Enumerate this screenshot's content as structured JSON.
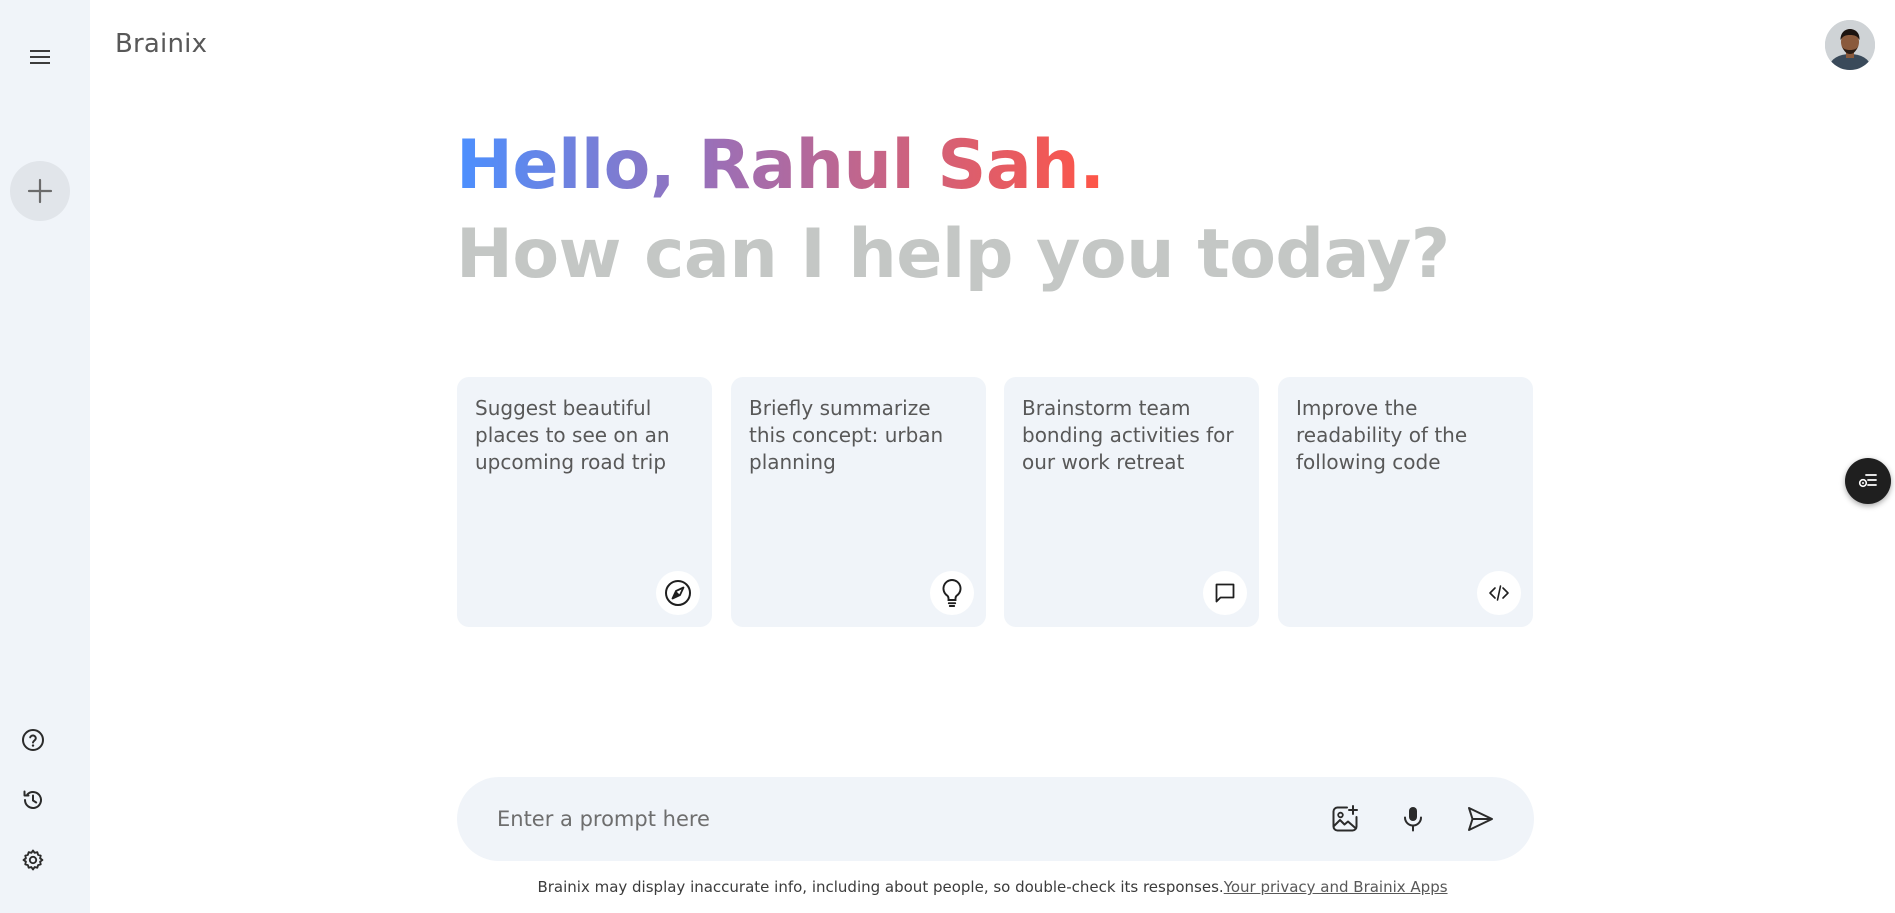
{
  "app": {
    "title": "Brainix"
  },
  "sidebar": {
    "menu_icon": "hamburger-menu-icon",
    "new_chat_icon": "plus-icon",
    "bottom_items": [
      {
        "name": "help",
        "icon": "question-circle-icon"
      },
      {
        "name": "history",
        "icon": "history-icon"
      },
      {
        "name": "settings",
        "icon": "gear-icon"
      }
    ]
  },
  "greeting": {
    "hello": "Hello, Rahul Sah.",
    "subtitle": "How can I help you today?"
  },
  "cards": [
    {
      "text": "Suggest beautiful places to see on an upcoming road trip",
      "icon": "compass-icon"
    },
    {
      "text": "Briefly summarize this concept: urban planning",
      "icon": "bulb-icon"
    },
    {
      "text": "Brainstorm team bonding activities for our work retreat",
      "icon": "message-icon"
    },
    {
      "text": "Improve the readability of the following code",
      "icon": "code-icon"
    }
  ],
  "prompt": {
    "placeholder": "Enter a prompt here",
    "icons": [
      "add-image-icon",
      "microphone-icon",
      "send-icon"
    ]
  },
  "footer": {
    "text": "Brainix may display inaccurate info, including about people, so double-check its responses.",
    "link": "Your privacy and Brainix Apps"
  },
  "colors": {
    "sidebar_bg": "#f0f4f9",
    "gradient_start": "#4b90ff",
    "gradient_end": "#ff5546",
    "subtitle": "#c4c7c5"
  }
}
